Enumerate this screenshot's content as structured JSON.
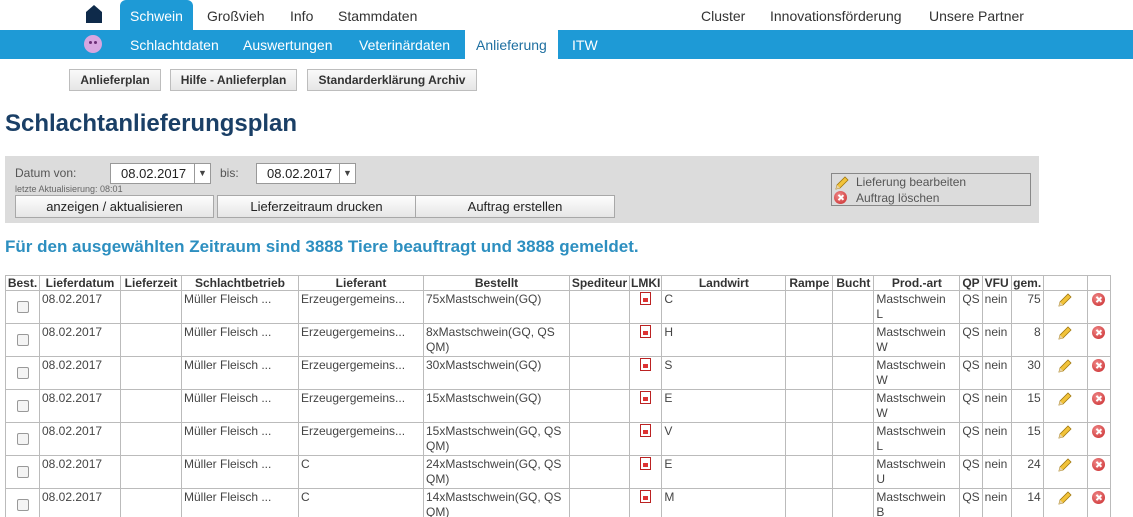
{
  "topnav": {
    "items": [
      "Schwein",
      "Großvieh",
      "Info",
      "Stammdaten"
    ],
    "right_items": [
      "Cluster",
      "Innovationsförderung",
      "Unsere Partner"
    ]
  },
  "subnav": {
    "items": [
      "Schlachtdaten",
      "Auswertungen",
      "Veterinärdaten",
      "Anlieferung",
      "ITW"
    ]
  },
  "subbuttons": [
    "Anlieferplan",
    "Hilfe - Anlieferplan",
    "Standarderklärung Archiv"
  ],
  "page_title": "Schlachtanlieferungsplan",
  "filter": {
    "date_from_label": "Datum von:",
    "date_from": "08.02.2017",
    "date_to_label": "bis:",
    "date_to": "08.02.2017",
    "last_update": "letzte Aktualisierung: 08:01",
    "btn_show": "anzeigen / aktualisieren",
    "btn_print": "Lieferzeitraum drucken",
    "btn_order": "Auftrag erstellen"
  },
  "legend": {
    "edit": "Lieferung bearbeiten",
    "delete": "Auftrag löschen"
  },
  "summary": "Für den ausgewählten Zeitraum sind 3888 Tiere beauftragt und 3888 gemeldet.",
  "table": {
    "headers": [
      "Best.",
      "Lieferdatum",
      "Lieferzeit",
      "Schlachtbetrieb",
      "Lieferant",
      "Bestellt",
      "Spediteur",
      "LMKI",
      "Landwirt",
      "Rampe",
      "Bucht",
      "Prod.-art",
      "QP",
      "VFU",
      "gem.",
      "",
      ""
    ],
    "rows": [
      {
        "date": "08.02.2017",
        "betrieb": "Müller Fleisch ...",
        "lieferant": "Erzeugergemeins...",
        "bestellt": "75xMastschwein(GQ)",
        "landwirt": "C",
        "prod": "Mastschwein",
        "prod2": "L",
        "qp": "QS",
        "vfu": "nein",
        "gem": "75"
      },
      {
        "date": "08.02.2017",
        "betrieb": "Müller Fleisch ...",
        "lieferant": "Erzeugergemeins...",
        "bestellt": "8xMastschwein(GQ, QS QM)",
        "landwirt": "H",
        "prod": "Mastschwein",
        "prod2": "W",
        "qp": "QS",
        "vfu": "nein",
        "gem": "8"
      },
      {
        "date": "08.02.2017",
        "betrieb": "Müller Fleisch ...",
        "lieferant": "Erzeugergemeins...",
        "bestellt": "30xMastschwein(GQ)",
        "landwirt": "S",
        "prod": "Mastschwein",
        "prod2": "W",
        "qp": "QS",
        "vfu": "nein",
        "gem": "30"
      },
      {
        "date": "08.02.2017",
        "betrieb": "Müller Fleisch ...",
        "lieferant": "Erzeugergemeins...",
        "bestellt": "15xMastschwein(GQ)",
        "landwirt": "E",
        "prod": "Mastschwein",
        "prod2": "W",
        "qp": "QS",
        "vfu": "nein",
        "gem": "15"
      },
      {
        "date": "08.02.2017",
        "betrieb": "Müller Fleisch ...",
        "lieferant": "Erzeugergemeins...",
        "bestellt": "15xMastschwein(GQ, QS QM)",
        "landwirt": "V",
        "prod": "Mastschwein",
        "prod2": "L",
        "qp": "QS",
        "vfu": "nein",
        "gem": "15"
      },
      {
        "date": "08.02.2017",
        "betrieb": "Müller Fleisch ...",
        "lieferant": "C",
        "bestellt": "24xMastschwein(GQ, QS QM)",
        "landwirt": "E",
        "prod": "Mastschwein",
        "prod2": "U",
        "qp": "QS",
        "vfu": "nein",
        "gem": "24"
      },
      {
        "date": "08.02.2017",
        "betrieb": "Müller Fleisch ...",
        "lieferant": "C",
        "bestellt": "14xMastschwein(GQ, QS QM)",
        "landwirt": "M",
        "prod": "Mastschwein",
        "prod2": "B",
        "qp": "QS",
        "vfu": "nein",
        "gem": "14"
      }
    ]
  },
  "colors": {
    "nav_blue": "#1e9ad6",
    "title_blue": "#1a3f66",
    "summary_blue": "#2d8fc0"
  }
}
